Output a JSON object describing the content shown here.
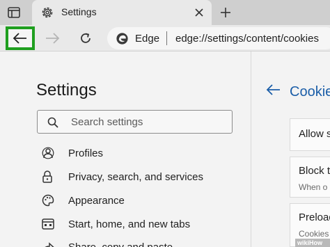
{
  "tab": {
    "title": "Settings"
  },
  "toolbar": {
    "brand": "Edge",
    "url": "edge://settings/content/cookies"
  },
  "nav": {
    "title": "Settings",
    "search_placeholder": "Search settings",
    "items": [
      {
        "label": "Profiles",
        "icon": "profiles-icon"
      },
      {
        "label": "Privacy, search, and services",
        "icon": "lock-icon"
      },
      {
        "label": "Appearance",
        "icon": "palette-icon"
      },
      {
        "label": "Start, home, and new tabs",
        "icon": "home-tabs-icon"
      },
      {
        "label": "Share, copy and paste",
        "icon": "share-icon"
      }
    ]
  },
  "content": {
    "title": "Cookie",
    "cards": [
      {
        "title": "Allow s"
      },
      {
        "title": "Block t",
        "subtitle": "When o"
      },
      {
        "title": "Preload",
        "subtitle": "Cookies"
      }
    ]
  },
  "watermark": "wikiHow",
  "colors": {
    "highlight": "#1f9f1f",
    "link": "#1b5ea8"
  }
}
